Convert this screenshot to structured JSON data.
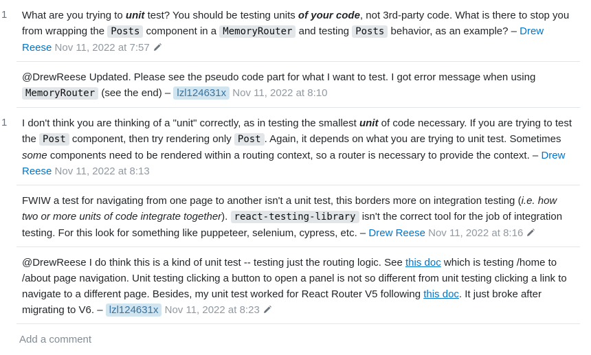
{
  "comments": [
    {
      "score": "1",
      "parts": {
        "t1": "What are you trying to ",
        "e1": "unit",
        "t2": " test? You should be testing units ",
        "e2": "of your code",
        "t3": ", not 3rd-party code. What is there to stop you from wrapping the ",
        "c1": "Posts",
        "t4": " component in a ",
        "c2": "MemoryRouter",
        "t5": " and testing ",
        "c3": "Posts",
        "t6": " behavior, as an example? – "
      },
      "user": "Drew Reese",
      "date": "Nov 11, 2022 at 7:57",
      "editable": true
    },
    {
      "score": "",
      "parts": {
        "t1": "@DrewReese Updated. Please see the pseudo code part for what I want to test. I got error message when using ",
        "c1": "MemoryRouter",
        "t2": " (see the end) – "
      },
      "user": "lzl124631x",
      "date": "Nov 11, 2022 at 8:10"
    },
    {
      "score": "1",
      "parts": {
        "t1": "I don't think you are thinking of a \"unit\" correctly, as in testing the smallest ",
        "e1": "unit",
        "t2": " of code necessary. If you are trying to test the ",
        "c1": "Post",
        "t3": " component, then try rendering only ",
        "c2": "Post",
        "t4": ". Again, it depends on what you are trying to unit test. Sometimes ",
        "i1": "some",
        "t5": " components need to be rendered within a routing context, so a router is necessary to provide the context. – "
      },
      "user": "Drew Reese",
      "date": "Nov 11, 2022 at 8:13"
    },
    {
      "score": "",
      "parts": {
        "t1": "FWIW a test for navigating from one page to another isn't a unit test, this borders more on integration testing (",
        "i1": "i.e. how two or more units of code integrate together",
        "t2": "). ",
        "c1": "react-testing-library",
        "t3": " isn't the correct tool for the job of integration testing. For this look for something like puppeteer, selenium, cypress, etc. – "
      },
      "user": "Drew Reese",
      "date": "Nov 11, 2022 at 8:16",
      "editable": true
    },
    {
      "score": "",
      "parts": {
        "t1": "@DrewReese I do think this is a kind of unit test -- testing just the routing logic. See ",
        "l1": "this doc",
        "t2": " which is testing /home to /about page navigation. Unit testing clicking a button to open a panel is not so different from unit testing clicking a link to navigate to a different page. Besides, my unit test worked for React Router V5 following ",
        "l2": "this doc",
        "t3": ". It just broke after migrating to V6. – "
      },
      "user": "lzl124631x",
      "date": "Nov 11, 2022 at 8:23",
      "editable": true
    }
  ],
  "add_comment_label": "Add a comment",
  "icons": {
    "edit": "pencil-icon"
  },
  "colors": {
    "link": "#0074cc",
    "owner_bg": "#d1e5f1",
    "owner_fg": "#39739d",
    "code_bg": "#e3e6e8",
    "muted": "#9199a1"
  }
}
